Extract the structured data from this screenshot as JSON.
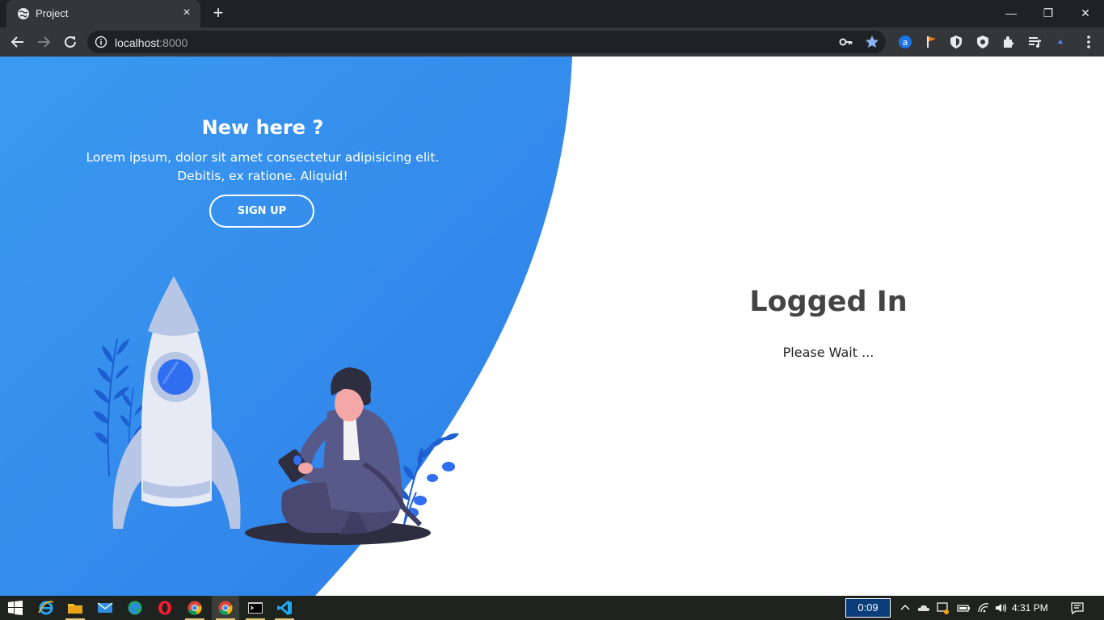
{
  "browser": {
    "tab_title": "Project",
    "tab_close": "×",
    "new_tab": "+",
    "url_host": "localhost",
    "url_port": ":8000",
    "window_controls": {
      "minimize": "—",
      "restore": "❐",
      "close": "✕"
    }
  },
  "left_panel": {
    "title": "New here ?",
    "text": "Lorem ipsum, dolor sit amet consectetur adipisicing elit. Debitis, ex ratione. Aliquid!",
    "button_label": "SIGN UP"
  },
  "right_panel": {
    "title": "Logged In",
    "subtitle": "Please Wait ..."
  },
  "taskbar": {
    "timer": "0:09",
    "clock": "4:31 PM"
  },
  "colors": {
    "panel_blue_start": "#3b9af0",
    "panel_blue_end": "#2d7ee8",
    "browser_dark": "#202124",
    "browser_toolbar": "#35363a"
  }
}
